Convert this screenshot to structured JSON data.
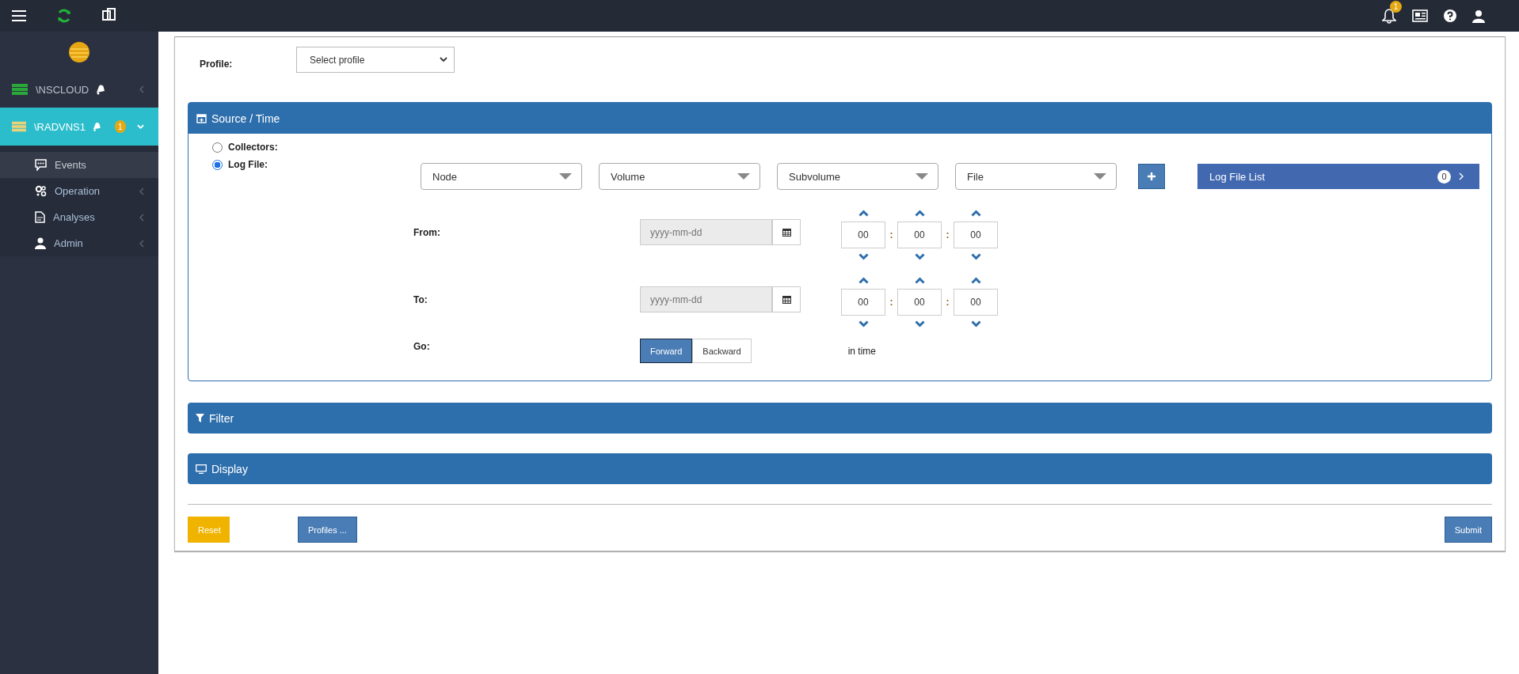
{
  "topbar": {
    "notification_count": "1"
  },
  "sidebar": {
    "nodes": [
      {
        "label": "\\NSCLOUD",
        "selected": false,
        "expanded": false
      },
      {
        "label": "\\RADVNS1",
        "selected": true,
        "expanded": true,
        "badge": "1"
      }
    ],
    "menu": [
      {
        "label": "Events",
        "kind": "events",
        "selected": true,
        "expandable": false
      },
      {
        "label": "Operation",
        "kind": "operation",
        "selected": false,
        "expandable": true
      },
      {
        "label": "Analyses",
        "kind": "analyses",
        "selected": false,
        "expandable": true
      },
      {
        "label": "Admin",
        "kind": "admin",
        "selected": false,
        "expandable": true
      }
    ]
  },
  "profile": {
    "label": "Profile:",
    "value": "Select profile"
  },
  "source_time": {
    "title": "Source / Time",
    "sources": [
      {
        "label": "Collectors:",
        "selected": false
      },
      {
        "label": "Log File:",
        "selected": true
      }
    ],
    "dropdowns": [
      "Node",
      "Volume",
      "Subvolume",
      "File"
    ],
    "log_file_list": {
      "label": "Log File List",
      "count": "0"
    },
    "ranges": [
      {
        "label": "From:",
        "date_placeholder": "yyyy-mm-dd",
        "time": [
          "00",
          "00",
          "00"
        ]
      },
      {
        "label": "To:",
        "date_placeholder": "yyyy-mm-dd",
        "time": [
          "00",
          "00",
          "00"
        ]
      }
    ],
    "time_separator": ":",
    "go": {
      "label": "Go:",
      "options": [
        {
          "label": "Forward",
          "selected": true
        },
        {
          "label": "Backward",
          "selected": false
        }
      ],
      "suffix": "in time"
    }
  },
  "sections": [
    {
      "title": "Filter",
      "kind": "filter"
    },
    {
      "title": "Display",
      "kind": "display"
    }
  ],
  "footer": {
    "left": [
      {
        "label": "Reset",
        "kind": "warning"
      },
      {
        "label": "Profiles ...",
        "kind": "primary"
      }
    ],
    "right": [
      {
        "label": "Submit",
        "kind": "primary"
      }
    ]
  }
}
